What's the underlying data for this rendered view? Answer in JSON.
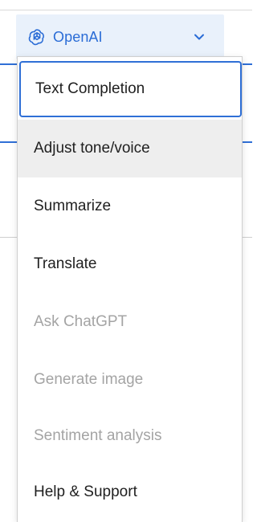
{
  "selector": {
    "provider_label": "OpenAI",
    "logo_icon": "openai-logo-icon",
    "chevron_icon": "chevron-down-icon",
    "accent_color": "#2a6cd6",
    "background_color": "#e9f1fb"
  },
  "menu": {
    "items": [
      {
        "label": "Text Completion",
        "state": "focused"
      },
      {
        "label": "Adjust tone/voice",
        "state": "hover"
      },
      {
        "label": "Summarize",
        "state": "enabled"
      },
      {
        "label": "Translate",
        "state": "enabled"
      },
      {
        "label": "Ask ChatGPT",
        "state": "disabled"
      },
      {
        "label": "Generate image",
        "state": "disabled"
      },
      {
        "label": "Sentiment analysis",
        "state": "disabled"
      },
      {
        "label": "Help & Support",
        "state": "enabled"
      }
    ],
    "focus_color": "#2f6fd6",
    "hover_color": "#eeeeee",
    "disabled_color": "#a4a4a4"
  }
}
